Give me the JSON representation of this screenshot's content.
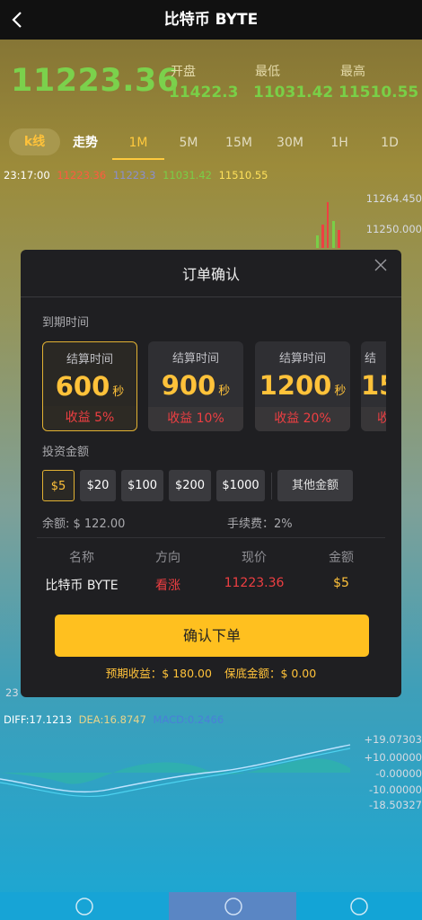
{
  "header": {
    "title": "比特币 BYTE"
  },
  "quote": {
    "price": "11223.36",
    "stats": [
      {
        "label": "开盘",
        "value": "11422.3"
      },
      {
        "label": "最低",
        "value": "11031.42"
      },
      {
        "label": "最高",
        "value": "11510.55"
      }
    ]
  },
  "tabs": [
    "k线",
    "走势",
    "1M",
    "5M",
    "15M",
    "30M",
    "1H",
    "1D"
  ],
  "ohlc": {
    "time": "23:17:00",
    "o": "11223.36",
    "h": "11223.3",
    "l": "11031.42",
    "c": "11510.55"
  },
  "axis": {
    "y1": "11264.450",
    "y2": "11250.000",
    "bottom_left": "23"
  },
  "macd": {
    "diff": "DIFF:17.1213",
    "dea": "DEA:16.8747",
    "macd": "MACD:0.2466",
    "axis": [
      "+19.07303",
      "+10.00000",
      "-0.00000",
      "-10.00000",
      "-18.50327"
    ]
  },
  "dialog": {
    "title": "订单确认",
    "expire_label": "到期时间",
    "cards": [
      {
        "label": "结算时间",
        "value": "600",
        "unit": "秒",
        "profit": "收益 5%"
      },
      {
        "label": "结算时间",
        "value": "900",
        "unit": "秒",
        "profit": "收益 10%"
      },
      {
        "label": "结算时间",
        "value": "1200",
        "unit": "秒",
        "profit": "收益 20%"
      },
      {
        "label": "结",
        "value": "15",
        "unit": "",
        "profit": "收"
      }
    ],
    "invest_label": "投资金额",
    "amounts": [
      "$5",
      "$20",
      "$100",
      "$200",
      "$1000"
    ],
    "other_amount": "其他金额",
    "balance": "余额: $ 122.00",
    "fee": "手续费：2%",
    "table_headers": [
      "名称",
      "方向",
      "现价",
      "金额"
    ],
    "row": {
      "name": "比特币 BYTE",
      "direction": "看涨",
      "price": "11223.36",
      "amount": "$5"
    },
    "confirm": "确认下单",
    "expected": "预期收益：$ 180.00",
    "deposit": "保底金额：$ 0.00"
  },
  "colors": {
    "accent": "#ffc23a",
    "up": "#79cf47",
    "down": "#ee3f42"
  }
}
